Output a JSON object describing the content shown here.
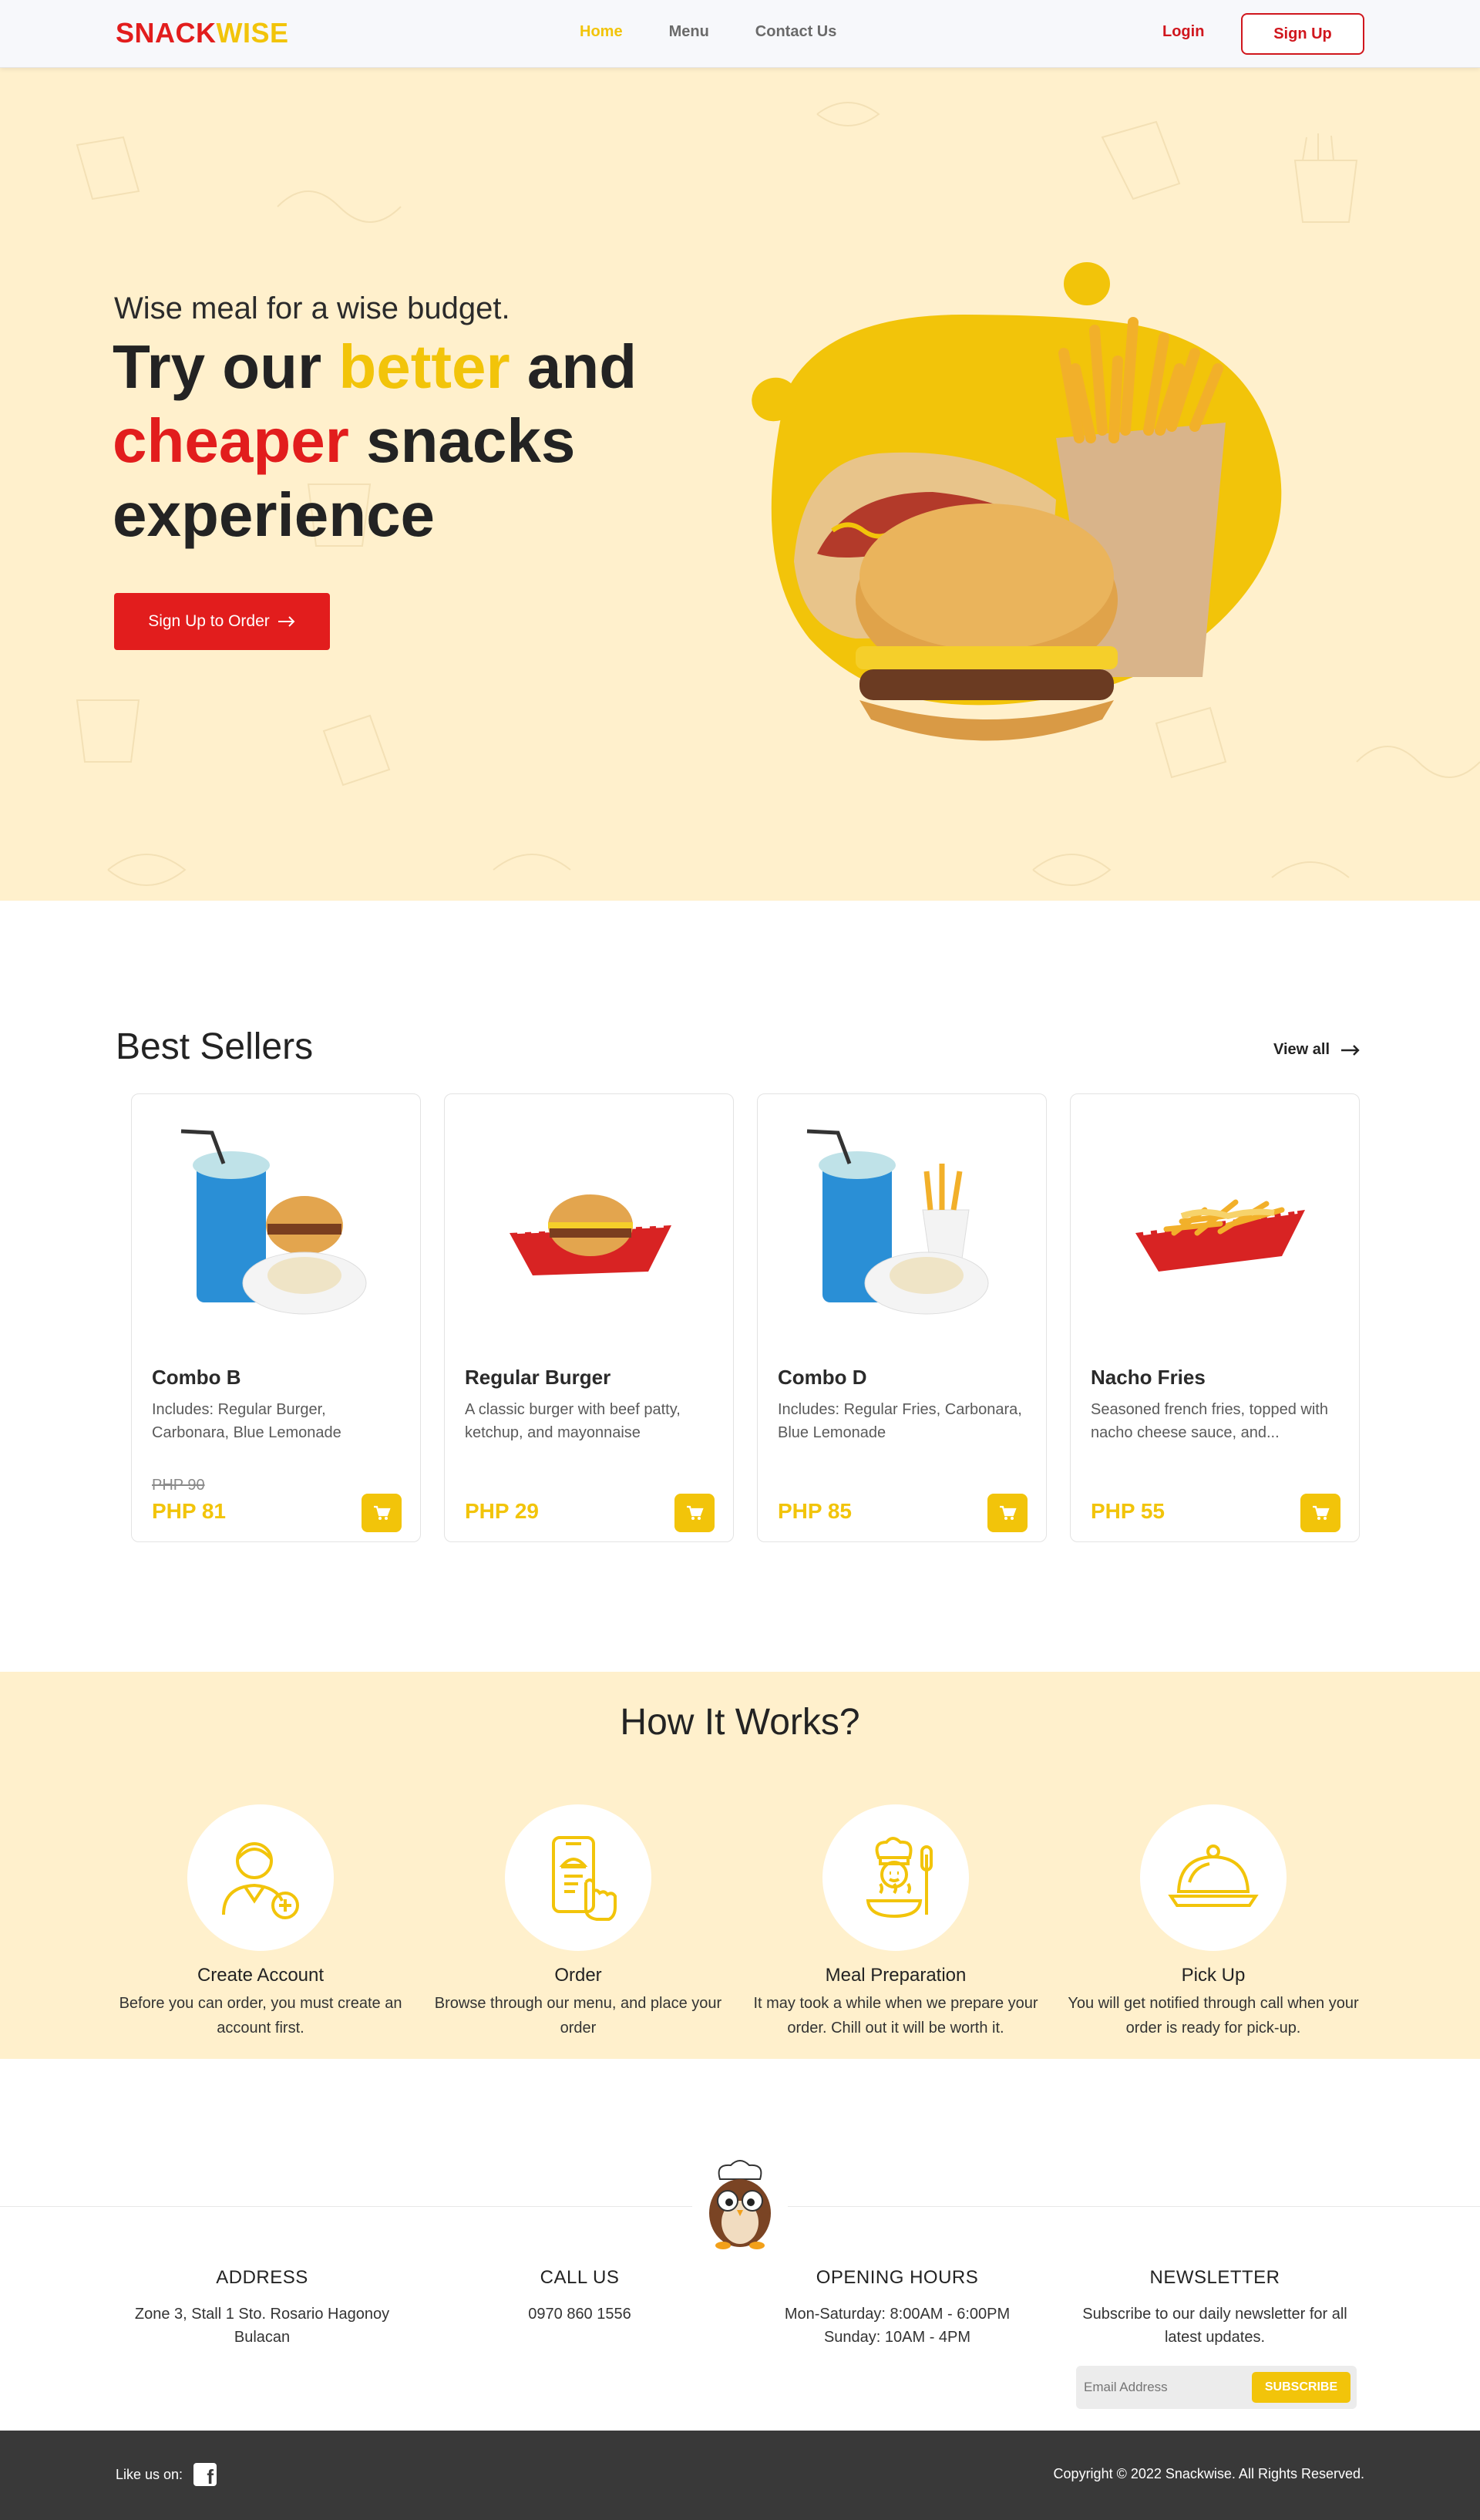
{
  "nav": {
    "logo_part1": "SNACK",
    "logo_part2": "WISE",
    "links": [
      "Home",
      "Menu",
      "Contact Us"
    ],
    "login": "Login",
    "signup": "Sign Up"
  },
  "hero": {
    "tagline": "Wise meal for a wise budget.",
    "headline_1": "Try our ",
    "headline_highlight_1": "better",
    "headline_2": " and ",
    "headline_highlight_2": "cheaper",
    "headline_3": " snacks experience",
    "cta": "Sign Up to Order"
  },
  "best_sellers": {
    "title": "Best Sellers",
    "view_all": "View all",
    "items": [
      {
        "name": "Combo B",
        "desc": "Includes: Regular Burger, Carbonara, Blue Lemonade",
        "old_price": "PHP 90",
        "price": "PHP 81"
      },
      {
        "name": "Regular Burger",
        "desc": "A classic burger with beef patty, ketchup, and mayonnaise",
        "old_price": "",
        "price": "PHP 29"
      },
      {
        "name": "Combo D",
        "desc": "Includes: Regular Fries, Carbonara, Blue Lemonade",
        "old_price": "",
        "price": "PHP 85"
      },
      {
        "name": "Nacho Fries",
        "desc": "Seasoned french fries, topped with nacho cheese sauce, and...",
        "old_price": "",
        "price": "PHP 55"
      }
    ]
  },
  "how": {
    "title": "How It Works?",
    "steps": [
      {
        "title": "Create Account",
        "desc": "Before you can order, you must create an account first.",
        "icon": "user-plus-icon"
      },
      {
        "title": "Order",
        "desc": "Browse through our menu, and place your order",
        "icon": "phone-tap-icon"
      },
      {
        "title": "Meal Preparation",
        "desc": "It may took a while when we prepare your order. Chill out it will be worth it.",
        "icon": "chef-icon"
      },
      {
        "title": "Pick Up",
        "desc": "You will get notified through call when your order is ready for pick-up.",
        "icon": "cloche-icon"
      }
    ]
  },
  "footer": {
    "address_title": "ADDRESS",
    "address": "Zone 3, Stall 1 Sto. Rosario Hagonoy Bulacan",
    "call_title": "CALL US",
    "phone": "0970 860 1556",
    "hours_title": "OPENING HOURS",
    "hours_1": "Mon-Saturday: 8:00AM - 6:00PM",
    "hours_2": "Sunday: 10AM - 4PM",
    "news_title": "NEWSLETTER",
    "news_desc": "Subscribe to our daily newsletter for all latest updates.",
    "email_placeholder": "Email Address",
    "subscribe": "SUBSCRIBE",
    "like_us": "Like us on:",
    "copyright": "Copyright © 2022 Snackwise. All Rights Reserved."
  },
  "colors": {
    "brand_red": "#e21d1d",
    "brand_yellow": "#f2c40a",
    "hero_bg": "#fff0cc",
    "footer_bg": "#393939"
  }
}
